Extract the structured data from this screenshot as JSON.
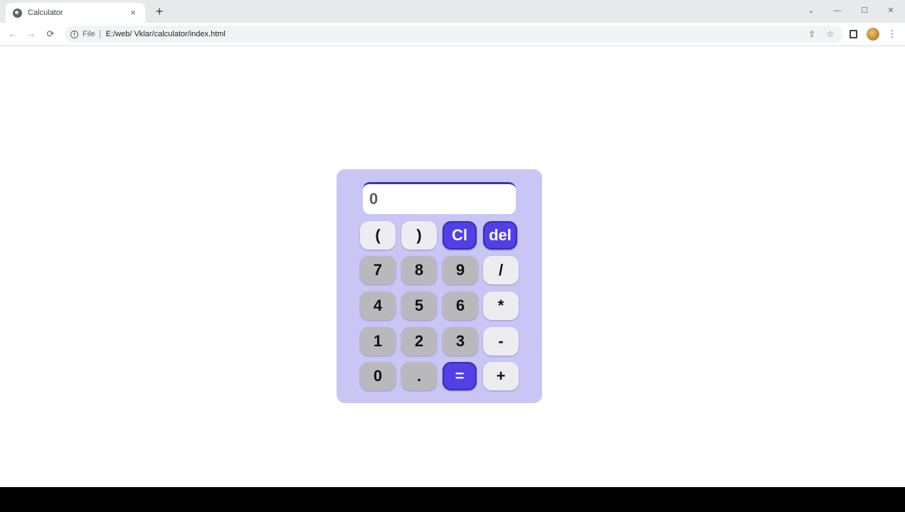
{
  "browser": {
    "tab_title": "Calculator",
    "tab_close": "×",
    "new_tab": "+",
    "file_label": "File",
    "url": "E:/web/ Vklar/calculator/index.html",
    "window_controls": {
      "chevron": "⌄",
      "minimize": "—",
      "maximize": "☐",
      "close": "✕"
    },
    "nav": {
      "back": "←",
      "forward": "→",
      "reload": "⟳"
    }
  },
  "calculator": {
    "display_value": "0",
    "rows": [
      [
        "(",
        ")",
        "Cl",
        "del"
      ],
      [
        "7",
        "8",
        "9",
        "/"
      ],
      [
        "4",
        "5",
        "6",
        "*"
      ],
      [
        "1",
        "2",
        "3",
        "-"
      ],
      [
        "0",
        ".",
        "=",
        "+"
      ]
    ]
  },
  "colors": {
    "calculator_bg": "#c9c6f6",
    "accent": "#5040e6",
    "digit_key": "#b9b9bd",
    "operator_key": "#ededf1"
  }
}
